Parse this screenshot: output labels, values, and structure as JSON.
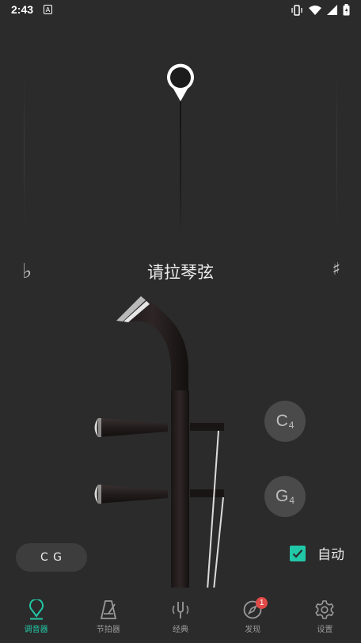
{
  "status_bar": {
    "time": "2:43",
    "app_icon_letter": "A",
    "icons": [
      "vibrate-icon",
      "wifi-icon",
      "signal-icon",
      "battery-icon"
    ]
  },
  "tuner": {
    "flat_symbol": "♭",
    "sharp_symbol": "♯",
    "prompt": "请拉琴弦"
  },
  "strings": {
    "upper": {
      "note": "C",
      "octave": "4"
    },
    "lower": {
      "note": "G",
      "octave": "4"
    }
  },
  "tuning_selector": {
    "label": "C G"
  },
  "auto": {
    "label": "自动",
    "checked": true
  },
  "nav": {
    "items": [
      {
        "label": "调音器",
        "icon": "tuner-pin-icon",
        "active": true
      },
      {
        "label": "节拍器",
        "icon": "metronome-icon",
        "active": false
      },
      {
        "label": "经典",
        "icon": "tuning-fork-icon",
        "active": false
      },
      {
        "label": "发现",
        "icon": "compass-icon",
        "active": false,
        "badge": "1"
      },
      {
        "label": "设置",
        "icon": "gear-icon",
        "active": false
      }
    ]
  },
  "colors": {
    "accent": "#21c8a7",
    "background": "#2b2b2b",
    "badge": "#e04a48"
  }
}
